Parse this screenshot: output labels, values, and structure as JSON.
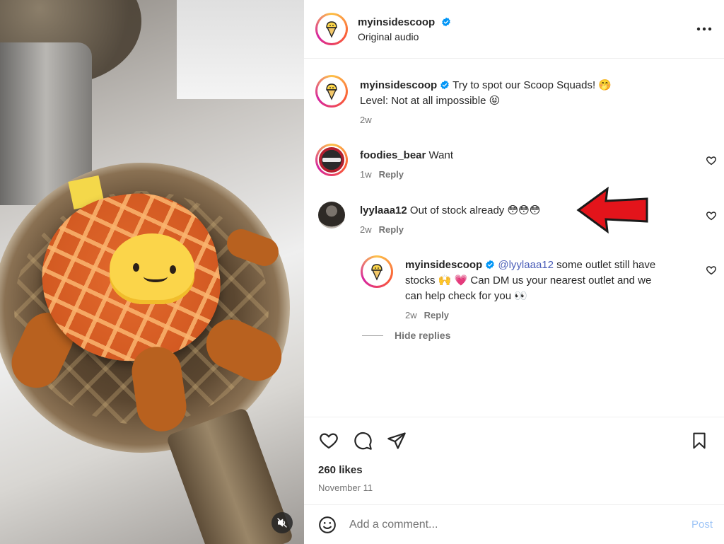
{
  "header": {
    "username": "myinsidescoop",
    "subtitle": "Original audio",
    "more_icon": "more-horizontal-icon"
  },
  "caption": {
    "username": "myinsidescoop",
    "text_line1": "Try to spot our Scoop Squads! 🤭",
    "text_line2": "Level: Not at all impossible 😝",
    "time": "2w"
  },
  "comments": [
    {
      "username": "foodies_bear",
      "text": "Want",
      "time": "1w",
      "reply_label": "Reply"
    },
    {
      "username": "lyylaaa12",
      "text": "Out of stock already 😳😳😳",
      "time": "2w",
      "reply_label": "Reply"
    }
  ],
  "reply": {
    "username": "myinsidescoop",
    "mention": "@lyylaaa12",
    "text_line1": "some outlet still have",
    "text_line2": "stocks 🙌 💗 Can DM us your nearest outlet and we",
    "text_line3": "can help check for you 👀",
    "time": "2w",
    "reply_label": "Reply"
  },
  "hide_replies_label": "Hide replies",
  "likes": "260 likes",
  "date": "November 11",
  "add_comment": {
    "placeholder": "Add a comment...",
    "post_label": "Post"
  },
  "colors": {
    "annotation_arrow": "#e3141b",
    "verified": "#0095f6",
    "post_disabled": "#9ec5f7",
    "mention": "#4a5db8"
  }
}
